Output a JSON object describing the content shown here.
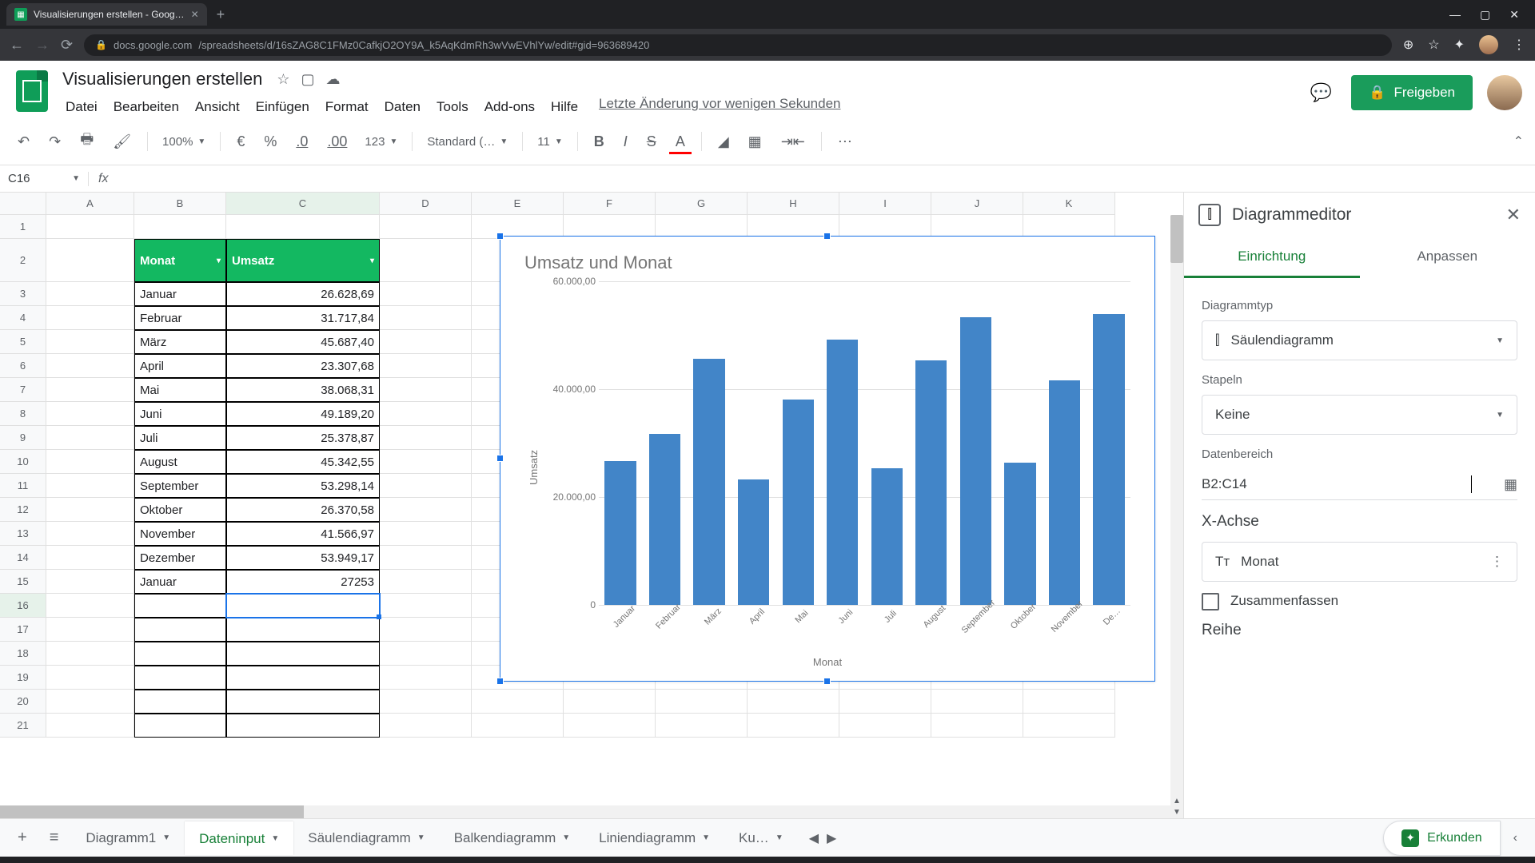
{
  "browser": {
    "tab_title": "Visualisierungen erstellen - Goog…",
    "url_host": "docs.google.com",
    "url_path": "/spreadsheets/d/16sZAG8C1FMz0CafkjO2OY9A_k5AqKdmRh3wVwEVhlYw/edit#gid=963689420"
  },
  "doc": {
    "title": "Visualisierungen erstellen",
    "last_edit": "Letzte Änderung vor wenigen Sekunden",
    "share": "Freigeben"
  },
  "menu": [
    "Datei",
    "Bearbeiten",
    "Ansicht",
    "Einfügen",
    "Format",
    "Daten",
    "Tools",
    "Add-ons",
    "Hilfe"
  ],
  "toolbar": {
    "zoom": "100%",
    "format_values": [
      "€",
      "%",
      ".0",
      ".00",
      "123"
    ],
    "font": "Standard (…",
    "font_size": "11"
  },
  "name_box": "C16",
  "fx": "fx",
  "table": {
    "headers": {
      "b": "Monat",
      "c": "Umsatz"
    },
    "rows": [
      {
        "b": "Januar",
        "c": "26.628,69"
      },
      {
        "b": "Februar",
        "c": "31.717,84"
      },
      {
        "b": "März",
        "c": "45.687,40"
      },
      {
        "b": "April",
        "c": "23.307,68"
      },
      {
        "b": "Mai",
        "c": "38.068,31"
      },
      {
        "b": "Juni",
        "c": "49.189,20"
      },
      {
        "b": "Juli",
        "c": "25.378,87"
      },
      {
        "b": "August",
        "c": "45.342,55"
      },
      {
        "b": "September",
        "c": "53.298,14"
      },
      {
        "b": "Oktober",
        "c": "26.370,58"
      },
      {
        "b": "November",
        "c": "41.566,97"
      },
      {
        "b": "Dezember",
        "c": "53.949,17"
      },
      {
        "b": "Januar",
        "c": "27253"
      }
    ]
  },
  "chart_data": {
    "type": "bar",
    "title": "Umsatz und Monat",
    "xlabel": "Monat",
    "ylabel": "Umsatz",
    "ylim": [
      0,
      60000
    ],
    "y_ticks": [
      "60.000,00",
      "40.000,00",
      "20.000,00",
      "0"
    ],
    "categories": [
      "Januar",
      "Februar",
      "März",
      "April",
      "Mai",
      "Juni",
      "Juli",
      "August",
      "September",
      "Oktober",
      "November",
      "De…"
    ],
    "values": [
      26628.69,
      31717.84,
      45687.4,
      23307.68,
      38068.31,
      49189.2,
      25378.87,
      45342.55,
      53298.14,
      26370.58,
      41566.97,
      53949.17
    ]
  },
  "sidebar": {
    "title": "Diagrammeditor",
    "tabs": {
      "setup": "Einrichtung",
      "customize": "Anpassen"
    },
    "chart_type_label": "Diagrammtyp",
    "chart_type_value": "Säulendiagramm",
    "stacking_label": "Stapeln",
    "stacking_value": "Keine",
    "data_range_label": "Datenbereich",
    "data_range_value": "B2:C14",
    "x_axis_label": "X-Achse",
    "x_axis_value": "Monat",
    "aggregate_label": "Zusammenfassen",
    "series_label": "Reihe"
  },
  "sheet_tabs": [
    "Diagramm1",
    "Dateninput",
    "Säulendiagramm",
    "Balkendiagramm",
    "Liniendiagramm",
    "Ku…"
  ],
  "explore": "Erkunden",
  "cols": {
    "A": 110,
    "B": 115,
    "C": 192,
    "other": 115
  },
  "col_letters": [
    "A",
    "B",
    "C",
    "D",
    "E",
    "F",
    "G",
    "H",
    "I",
    "J",
    "K"
  ]
}
